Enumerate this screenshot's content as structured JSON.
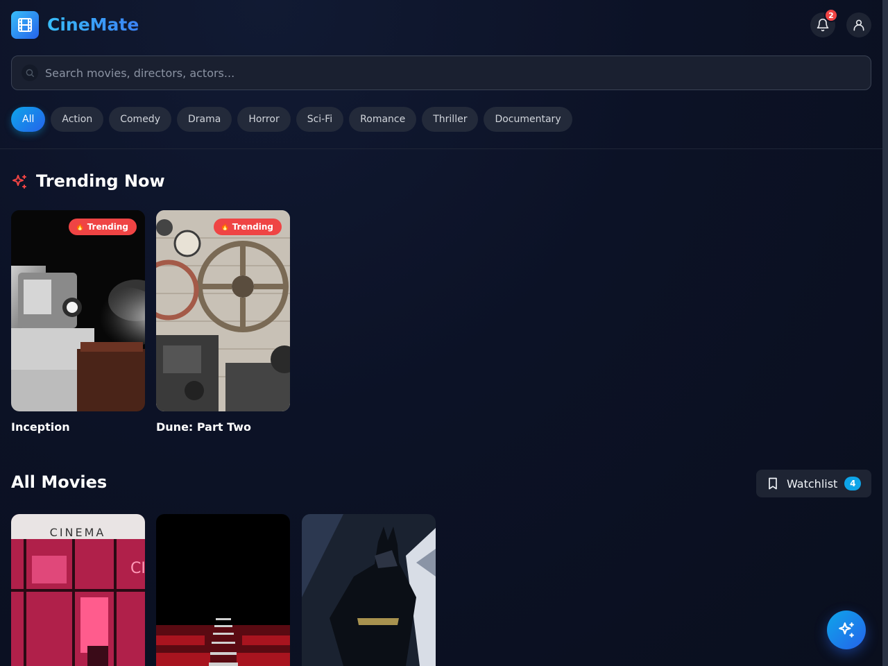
{
  "app": {
    "title": "CineMate",
    "notifications_count": "2",
    "icons": {
      "logo": "film-icon",
      "notifications": "bell-icon",
      "profile": "user-icon",
      "search": "search-icon",
      "section": "sparkles-icon",
      "watchlist": "bookmark-icon",
      "fab": "sparkles-icon"
    }
  },
  "search": {
    "placeholder": "Search movies, directors, actors...",
    "value": ""
  },
  "categories": {
    "selected": "All",
    "items": [
      "All",
      "Action",
      "Comedy",
      "Drama",
      "Horror",
      "Sci-Fi",
      "Romance",
      "Thriller",
      "Documentary"
    ]
  },
  "trending": {
    "title": "Trending Now",
    "badge_label": "Trending",
    "movies": [
      {
        "title": "Inception"
      },
      {
        "title": "Dune: Part Two"
      }
    ]
  },
  "all_movies": {
    "title": "All Movies",
    "watchlist_label": "Watchlist",
    "watchlist_count": "4"
  },
  "colors": {
    "accent": "#0ea5e9",
    "accent_deep": "#2563eb",
    "trending_badge": "#ef4444",
    "background": "#0c1226"
  }
}
